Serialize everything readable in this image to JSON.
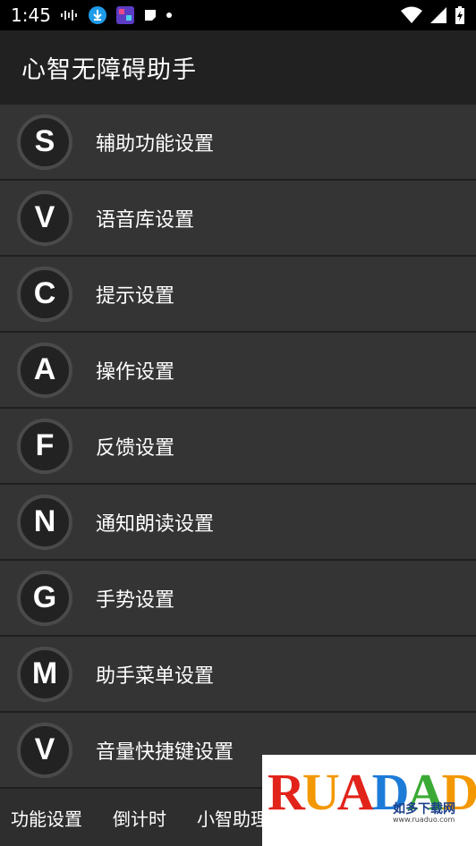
{
  "status_bar": {
    "time": "1:45",
    "icons_left": [
      "audio-wave-icon",
      "download-icon",
      "app-thumbnail-icon",
      "note-icon",
      "dot-icon"
    ],
    "icons_right": [
      "wifi-icon",
      "signal-icon",
      "battery-charging-icon"
    ]
  },
  "app_bar": {
    "title": "心智无障碍助手"
  },
  "list": {
    "items": [
      {
        "letter": "S",
        "label": "辅助功能设置"
      },
      {
        "letter": "V",
        "label": "语音库设置"
      },
      {
        "letter": "C",
        "label": "提示设置"
      },
      {
        "letter": "A",
        "label": "操作设置"
      },
      {
        "letter": "F",
        "label": "反馈设置"
      },
      {
        "letter": "N",
        "label": "通知朗读设置"
      },
      {
        "letter": "G",
        "label": "手势设置"
      },
      {
        "letter": "M",
        "label": "助手菜单设置"
      },
      {
        "letter": "V",
        "label": "音量快捷键设置"
      }
    ]
  },
  "bottom_tabs": [
    "功能设置",
    "倒计时",
    "小智助理"
  ],
  "watermark": {
    "logo": "RUANDUO",
    "cn": "如多下载网",
    "url": "www.ruaduo.com"
  },
  "colors": {
    "status_bar": "#000000",
    "app_bar": "#212121",
    "list_bg": "#343434",
    "circle_bg": "#222222",
    "circle_border": "#4a4a4a",
    "text": "#ffffff"
  }
}
